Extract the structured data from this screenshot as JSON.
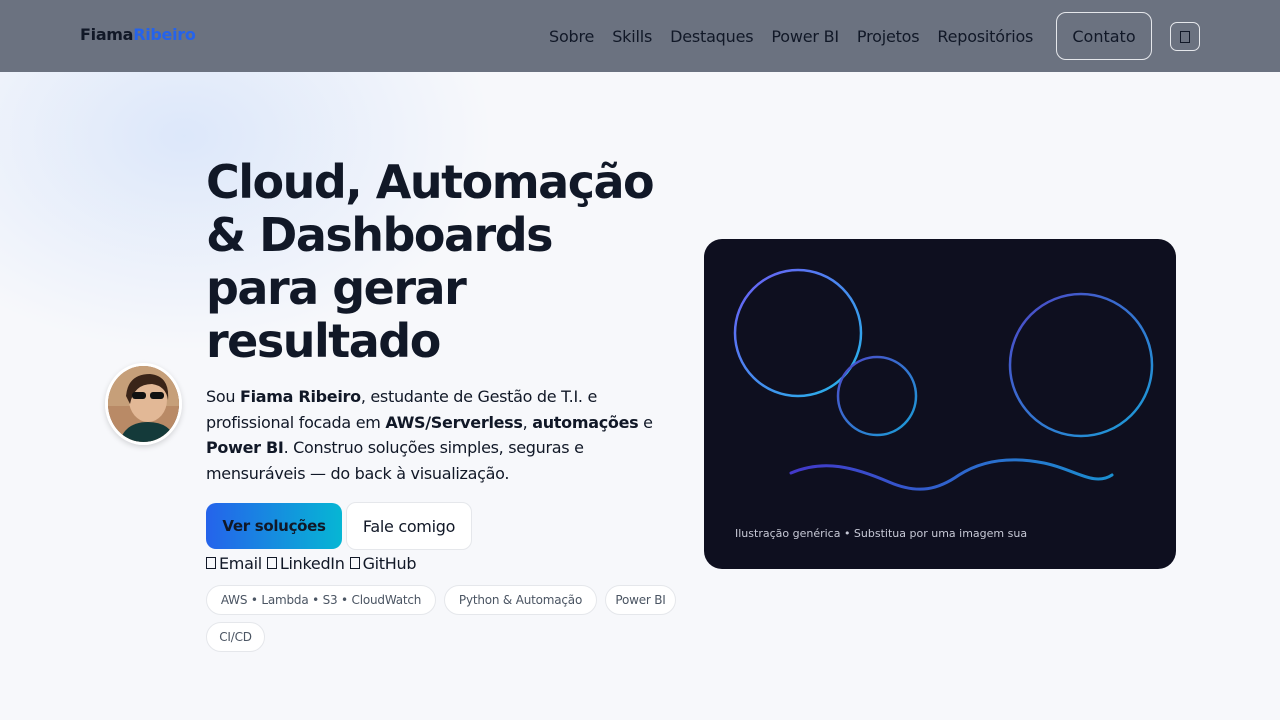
{
  "header": {
    "brand_first": "Fiama",
    "brand_second": "Ribeiro",
    "nav": [
      "Sobre",
      "Skills",
      "Destaques",
      "Power BI",
      "Projetos",
      "Repositórios"
    ],
    "contact_label": "Contato",
    "theme_toggle_icon": "theme-toggle-icon"
  },
  "hero": {
    "title_lines": [
      "Cloud, Automação",
      "& Dashboards",
      "para gerar",
      "resultado"
    ],
    "intro": {
      "t1": "Sou ",
      "name": "Fiama Ribeiro",
      "t2": ", estudante de Gestão de T.I. e profissional focada em ",
      "b1": "AWS/Serverless",
      "t3": ", ",
      "b2": "automações",
      "t4": " e ",
      "b3": "Power BI",
      "t5": ". Construo soluções simples, seguras e mensuráveis — do back à visualização."
    },
    "primary_cta": "Ver soluções",
    "secondary_cta": "Fale comigo",
    "links": [
      {
        "label": "Email",
        "icon": "email-icon"
      },
      {
        "label": "LinkedIn",
        "icon": "linkedin-icon"
      },
      {
        "label": "GitHub",
        "icon": "github-icon"
      }
    ],
    "chips": [
      "AWS • Lambda • S3 • CloudWatch",
      "Python & Automação",
      "Power BI",
      "CI/CD"
    ]
  },
  "illustration": {
    "caption": "Ilustração genérica • Substitua por uma imagem sua"
  },
  "colors": {
    "header_bg": "#6b7280",
    "accent": "#2563eb",
    "gradient_end": "#06b6d4",
    "card_bg": "#0e0f1f"
  }
}
